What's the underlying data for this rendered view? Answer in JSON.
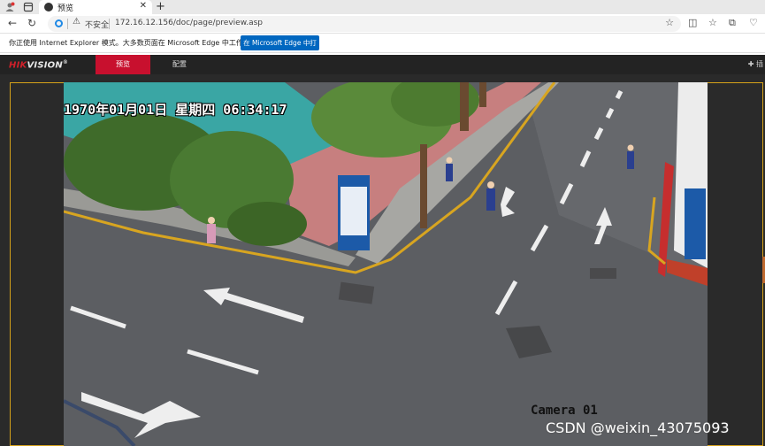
{
  "browser": {
    "tab_title": "预览",
    "tab_close": "✕",
    "new_tab": "+",
    "security_label": "不安全",
    "url": "172.16.12.156/doc/page/preview.asp"
  },
  "infobar": {
    "message": "你正使用 Internet Explorer 模式。大多数页面在 Microsoft Edge 中工作效果更佳。",
    "open_button": "在 Microsoft Edge 中打开"
  },
  "app": {
    "logo_hik": "HIK",
    "logo_vision": "VISION",
    "logo_mark": "®",
    "nav_preview": "预览",
    "nav_config": "配置",
    "plugin_label": "插"
  },
  "video": {
    "osd_datetime": "1970年01月01日 星期四 06:34:17",
    "osd_camera": "Camera 01"
  },
  "watermark": "CSDN @weixin_43075093",
  "colors": {
    "brand_red": "#c8102e",
    "edge_blue": "#0067c0",
    "viewer_border": "#d6a21a"
  }
}
